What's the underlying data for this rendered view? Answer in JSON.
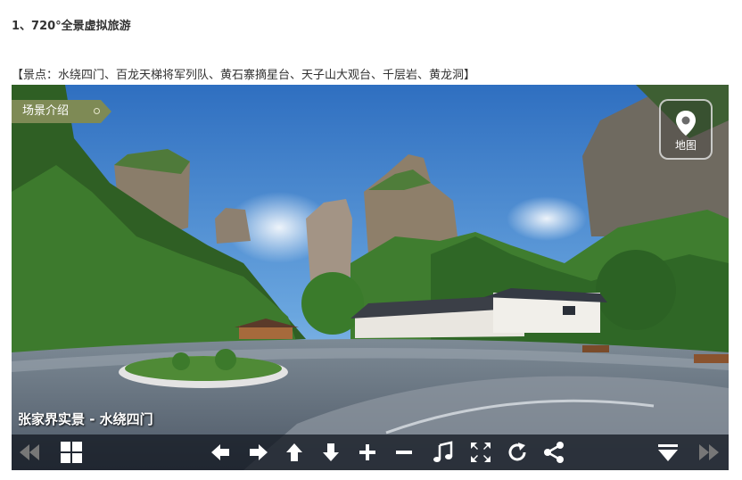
{
  "heading": "1、720°全景虚拟旅游",
  "spots": "【景点：水绕四门、百龙天梯将军列队、黄石寨摘星台、天子山大观台、千层岩、黄龙洞】",
  "viewer": {
    "intro_label": "场景介绍",
    "map_label": "地图",
    "scene_title": "张家界实景 - 水绕四门",
    "toolbar": {
      "icons": [
        "prev-icon",
        "thumbnails-icon",
        "arrow-left-icon",
        "arrow-right-icon",
        "arrow-up-icon",
        "arrow-down-icon",
        "zoom-in-icon",
        "zoom-out-icon",
        "music-icon",
        "fullscreen-icon",
        "rotate-icon",
        "share-icon",
        "collapse-icon",
        "next-icon"
      ]
    }
  },
  "colors": {
    "tag_bg": "#7e8a55",
    "toolbar_bg": "#141923",
    "sky": "#3f80c8"
  }
}
